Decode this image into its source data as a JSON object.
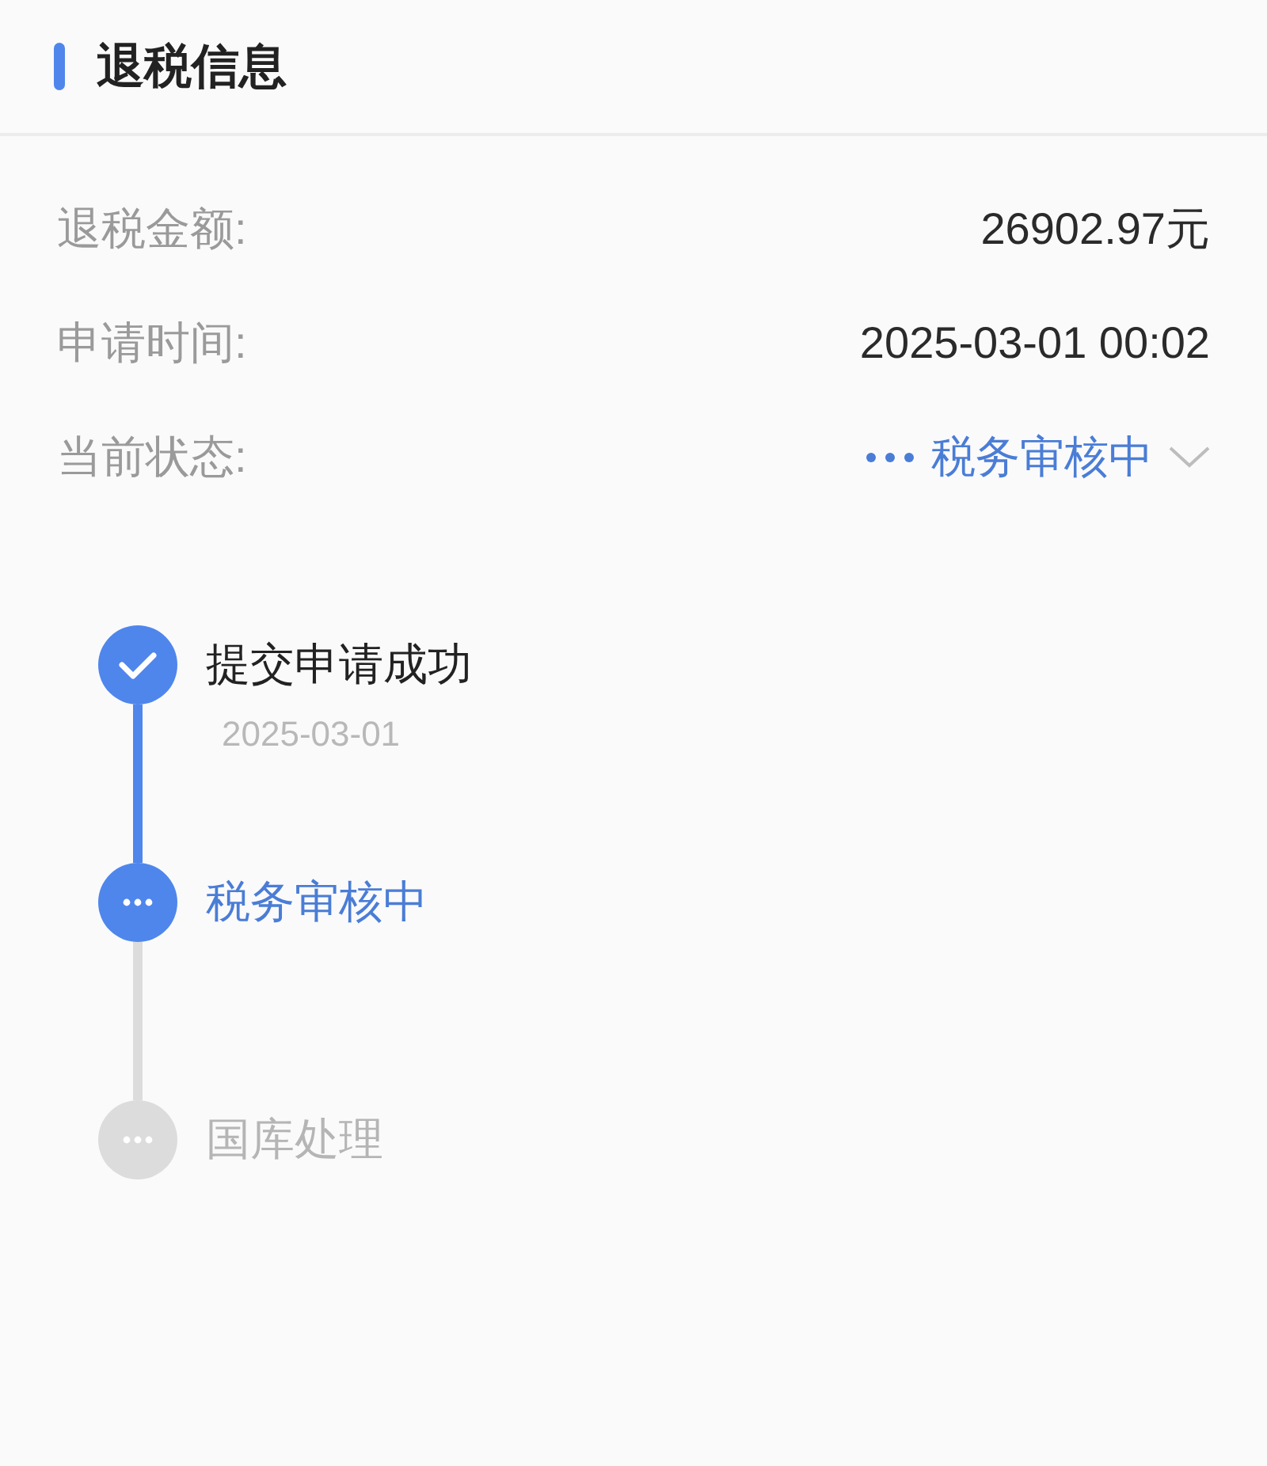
{
  "section": {
    "title": "退税信息"
  },
  "details": [
    {
      "kind": "plain",
      "label": "退税金额:",
      "value": "26902.97元"
    },
    {
      "kind": "plain",
      "label": "申请时间:",
      "value": "2025-03-01 00:02"
    },
    {
      "kind": "status",
      "label": "当前状态:",
      "value": "税务审核中"
    }
  ],
  "progress": [
    {
      "done": true,
      "active": false,
      "title": "提交申请成功",
      "date": "2025-03-01"
    },
    {
      "done": false,
      "active": true,
      "title": "税务审核中"
    },
    {
      "done": false,
      "active": false,
      "title": "国库处理"
    }
  ]
}
